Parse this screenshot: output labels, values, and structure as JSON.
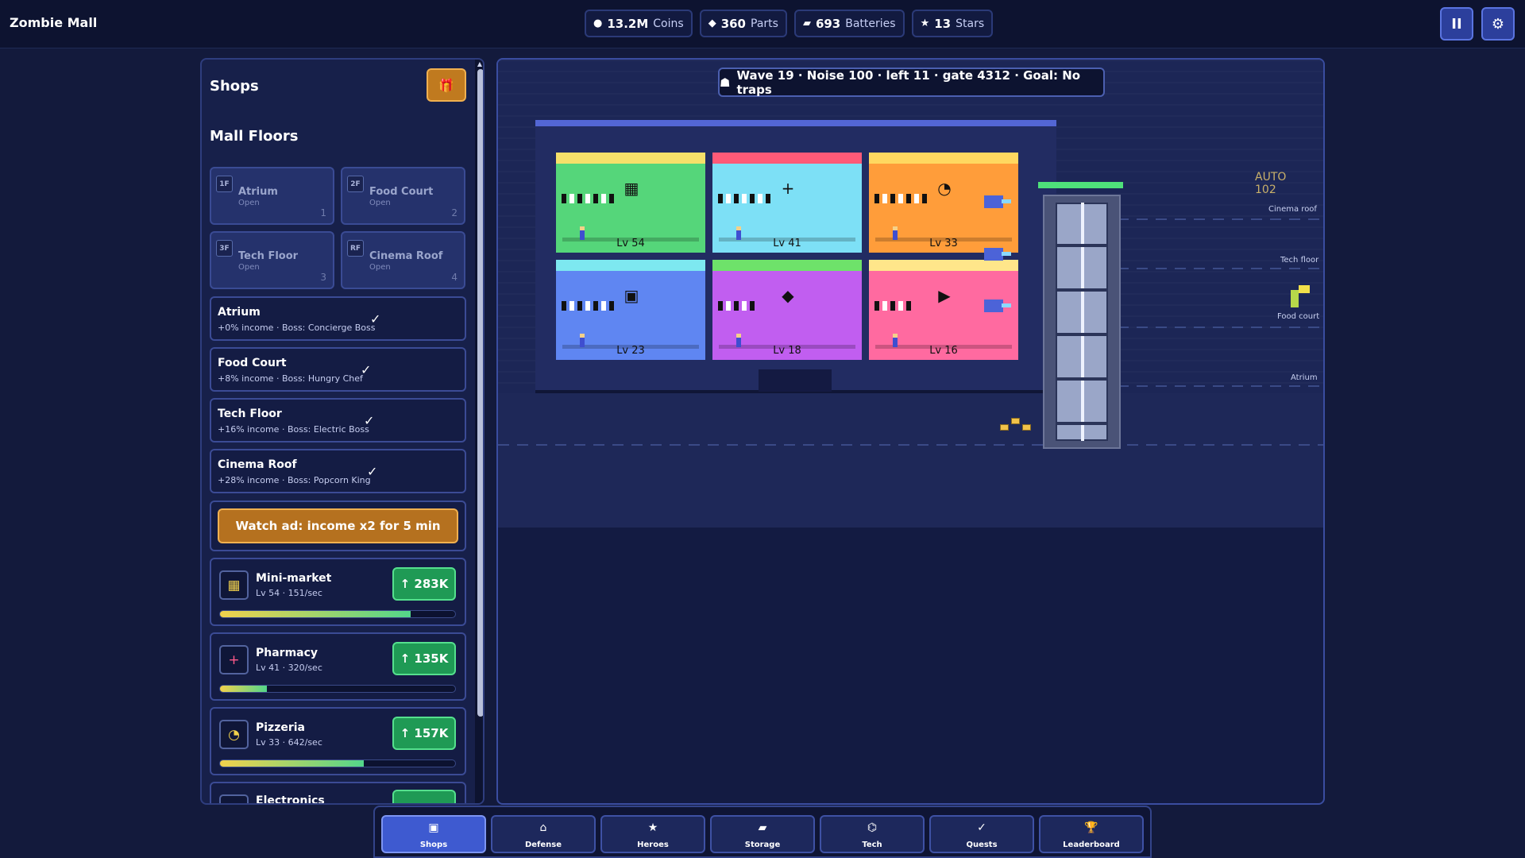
{
  "app": {
    "title": "Zombie Mall"
  },
  "resources": [
    {
      "icon": "●",
      "value": "13.2M",
      "unit": "Coins",
      "name": "coins"
    },
    {
      "icon": "◆",
      "value": "360",
      "unit": "Parts",
      "name": "parts"
    },
    {
      "icon": "▰",
      "value": "693",
      "unit": "Batteries",
      "name": "batteries"
    },
    {
      "icon": "★",
      "value": "13",
      "unit": "Stars",
      "name": "stars"
    }
  ],
  "top_buttons": {
    "pause": "II",
    "settings": "⚙"
  },
  "panel": {
    "title": "Shops",
    "gift_icon": "🎁",
    "floors_title": "Mall Floors",
    "floors": [
      {
        "tag": "1F",
        "name": "Atrium",
        "status": "Open",
        "num": "1"
      },
      {
        "tag": "2F",
        "name": "Food Court",
        "status": "Open",
        "num": "2"
      },
      {
        "tag": "3F",
        "name": "Tech Floor",
        "status": "Open",
        "num": "3"
      },
      {
        "tag": "RF",
        "name": "Cinema Roof",
        "status": "Open",
        "num": "4"
      }
    ],
    "bosses": [
      {
        "name": "Atrium",
        "desc": "+0% income · Boss: Concierge Boss",
        "check": "✓"
      },
      {
        "name": "Food Court",
        "desc": "+8% income · Boss: Hungry Chef",
        "check": "✓"
      },
      {
        "name": "Tech Floor",
        "desc": "+16% income · Boss: Electric Boss",
        "check": "✓"
      },
      {
        "name": "Cinema Roof",
        "desc": "+28% income · Boss: Popcorn King",
        "check": "✓"
      }
    ],
    "ad_button": "Watch ad: income x2 for 5 min",
    "shops": [
      {
        "icon": "▦",
        "icon_color": "#f2d24c",
        "name": "Mini-market",
        "stat": "Lv 54 · 151/sec",
        "upgrade": "↑ 283K",
        "progress": 0.81
      },
      {
        "icon": "+",
        "icon_color": "#ff5a8a",
        "name": "Pharmacy",
        "stat": "Lv 41 · 320/sec",
        "upgrade": "↑ 135K",
        "progress": 0.2
      },
      {
        "icon": "◔",
        "icon_color": "#f2d24c",
        "name": "Pizzeria",
        "stat": "Lv 33 · 642/sec",
        "upgrade": "↑ 157K",
        "progress": 0.61
      },
      {
        "icon": "▭",
        "icon_color": "#4ee0a0",
        "name": "Electronics",
        "stat": "",
        "upgrade": "",
        "progress": 0
      }
    ]
  },
  "game": {
    "wave_icon": "☗",
    "wave_text": "Wave 19 · Noise 100 · left 11 · gate 4312 · Goal: No traps",
    "rooms": [
      {
        "symbol": "▦",
        "level": "Lv 54",
        "color": "#55d67a",
        "strip": "#f6e06a"
      },
      {
        "symbol": "+",
        "level": "Lv 41",
        "color": "#7de0f6",
        "strip": "#ff5a78"
      },
      {
        "symbol": "◔",
        "level": "Lv 33",
        "color": "#ff9d3a",
        "strip": "#ffd860"
      },
      {
        "symbol": "▣",
        "level": "Lv 23",
        "color": "#5f86f2",
        "strip": "#7de8f0"
      },
      {
        "symbol": "◆",
        "level": "Lv 18",
        "color": "#c15ef0",
        "strip": "#6ee26a"
      },
      {
        "symbol": "▶",
        "level": "Lv 16",
        "color": "#ff6aa0",
        "strip": "#ffe68a"
      }
    ],
    "auto_label": "AUTO",
    "auto_value": "102",
    "zones": [
      "Cinema roof",
      "Tech floor",
      "Food court",
      "Atrium"
    ]
  },
  "nav": [
    {
      "icon": "▣",
      "label": "Shops",
      "active": true
    },
    {
      "icon": "⌂",
      "label": "Defense",
      "active": false
    },
    {
      "icon": "★",
      "label": "Heroes",
      "active": false
    },
    {
      "icon": "▰",
      "label": "Storage",
      "active": false
    },
    {
      "icon": "⌬",
      "label": "Tech",
      "active": false
    },
    {
      "icon": "✓",
      "label": "Quests",
      "active": false
    },
    {
      "icon": "🏆",
      "label": "Leaderboard",
      "active": false
    }
  ]
}
